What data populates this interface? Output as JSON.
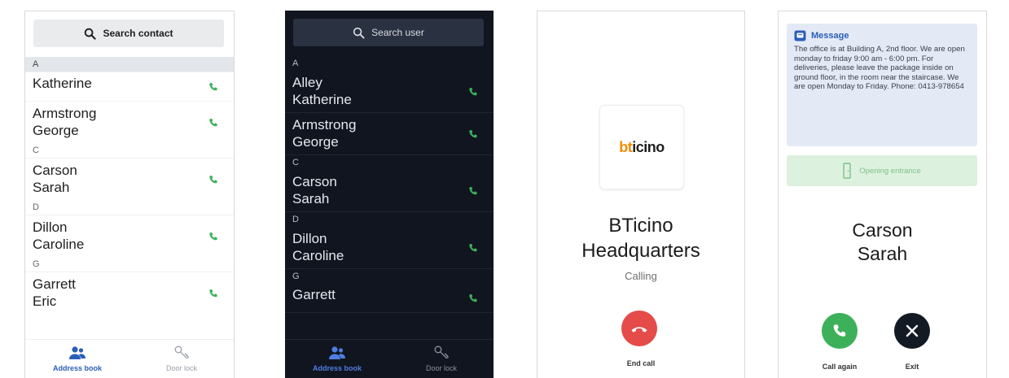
{
  "colors": {
    "accent": "#2b5eb8",
    "phone_green": "#3db05a",
    "end_call_red": "#e54b48",
    "dark_bg": "#10151f"
  },
  "screen1": {
    "search": {
      "label": "Search contact",
      "icon": "search-icon"
    },
    "sections": [
      {
        "letter": "A",
        "contacts": [
          {
            "name": "Katherine",
            "partial": true
          },
          {
            "name": "Armstrong\nGeorge"
          }
        ]
      },
      {
        "letter": "C",
        "contacts": [
          {
            "name": "Carson\nSarah"
          }
        ]
      },
      {
        "letter": "D",
        "contacts": [
          {
            "name": "Dillon\nCaroline"
          }
        ]
      },
      {
        "letter": "G",
        "contacts": [
          {
            "name": "Garrett\nEric"
          }
        ]
      }
    ],
    "tabs": [
      {
        "label": "Address book",
        "icon": "address-book-icon",
        "active": true
      },
      {
        "label": "Door lock",
        "icon": "key-icon",
        "active": false
      }
    ]
  },
  "screen2": {
    "search": {
      "label": "Search user",
      "icon": "search-icon"
    },
    "sections": [
      {
        "letter": "A",
        "contacts": [
          {
            "name": "Alley\nKatherine"
          },
          {
            "name": "Armstrong\nGeorge"
          }
        ]
      },
      {
        "letter": "C",
        "contacts": [
          {
            "name": "Carson\nSarah"
          }
        ]
      },
      {
        "letter": "D",
        "contacts": [
          {
            "name": "Dillon\nCaroline"
          }
        ]
      },
      {
        "letter": "G",
        "contacts": [
          {
            "name": "Garrett"
          }
        ]
      }
    ],
    "tabs": [
      {
        "label": "Address book",
        "icon": "address-book-icon",
        "active": true
      },
      {
        "label": "Door lock",
        "icon": "key-icon",
        "active": false
      }
    ]
  },
  "screen3": {
    "logo": {
      "part1": "bt",
      "part2": "icino"
    },
    "callee_line1": "BTicino",
    "callee_line2": "Headquarters",
    "status": "Calling",
    "end_call_label": "End call"
  },
  "screen4": {
    "message_title": "Message",
    "message_body": "The office is at Building A, 2nd floor. We are open monday to friday 9:00 am - 6:00 pm. For deliveries, please leave the package inside on ground floor, in the room near the staircase. We are open Monday to Friday. Phone: 0413-978654",
    "opening_label": "Opening entrance",
    "caller_line1": "Carson",
    "caller_line2": "Sarah",
    "call_again_label": "Call again",
    "exit_label": "Exit"
  }
}
